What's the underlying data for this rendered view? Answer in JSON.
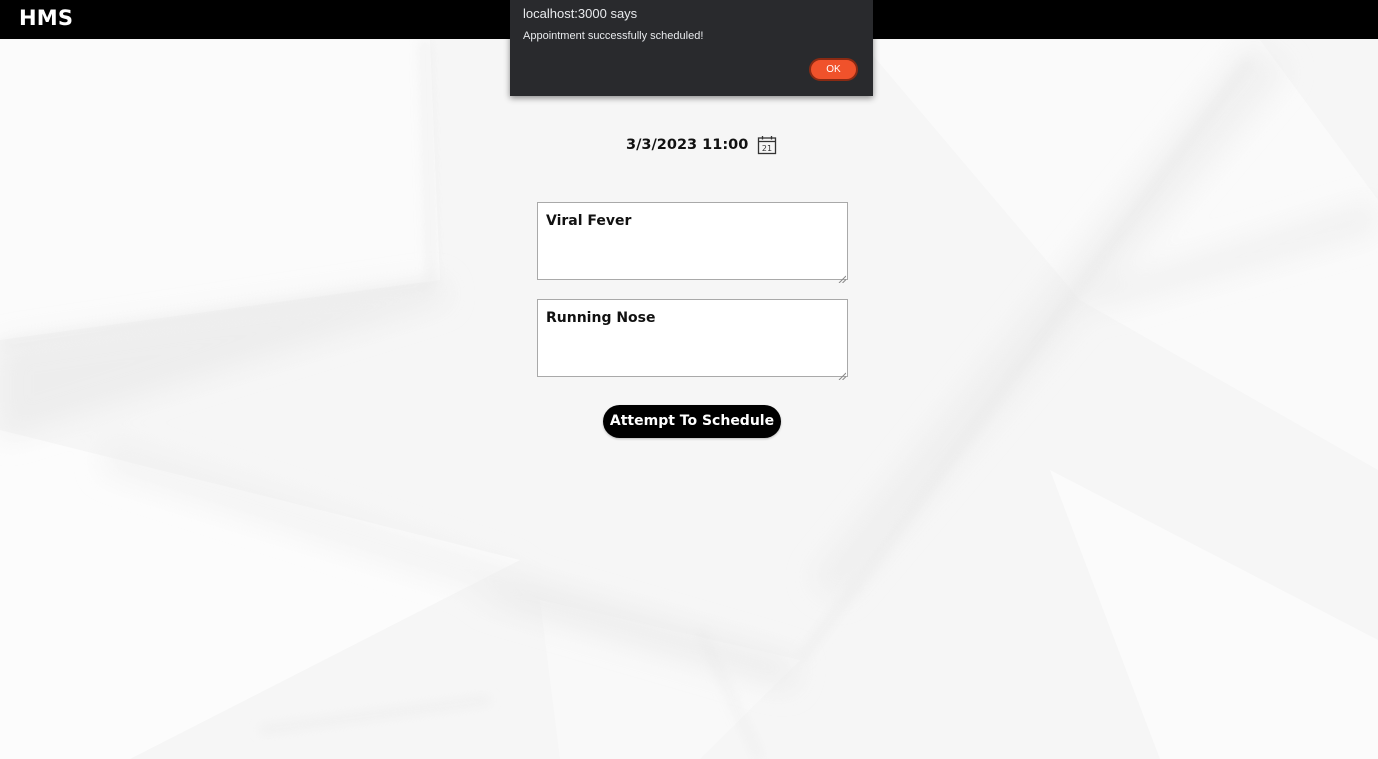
{
  "header": {
    "brand": "HMS"
  },
  "appointment": {
    "datetime": "3/3/2023 11:00",
    "datetime_icon": "calendar-icon",
    "calendar_day": "21",
    "field1_value": "Viral Fever",
    "field2_value": "Running Nose",
    "submit_label": "Attempt To Schedule"
  },
  "dialog": {
    "title": "localhost:3000 says",
    "message": "Appointment successfully scheduled!",
    "ok_label": "OK"
  },
  "colors": {
    "topbar": "#000000",
    "dialog_bg": "#292a2d",
    "ok_button": "#f0522b",
    "submit_button": "#000000"
  }
}
